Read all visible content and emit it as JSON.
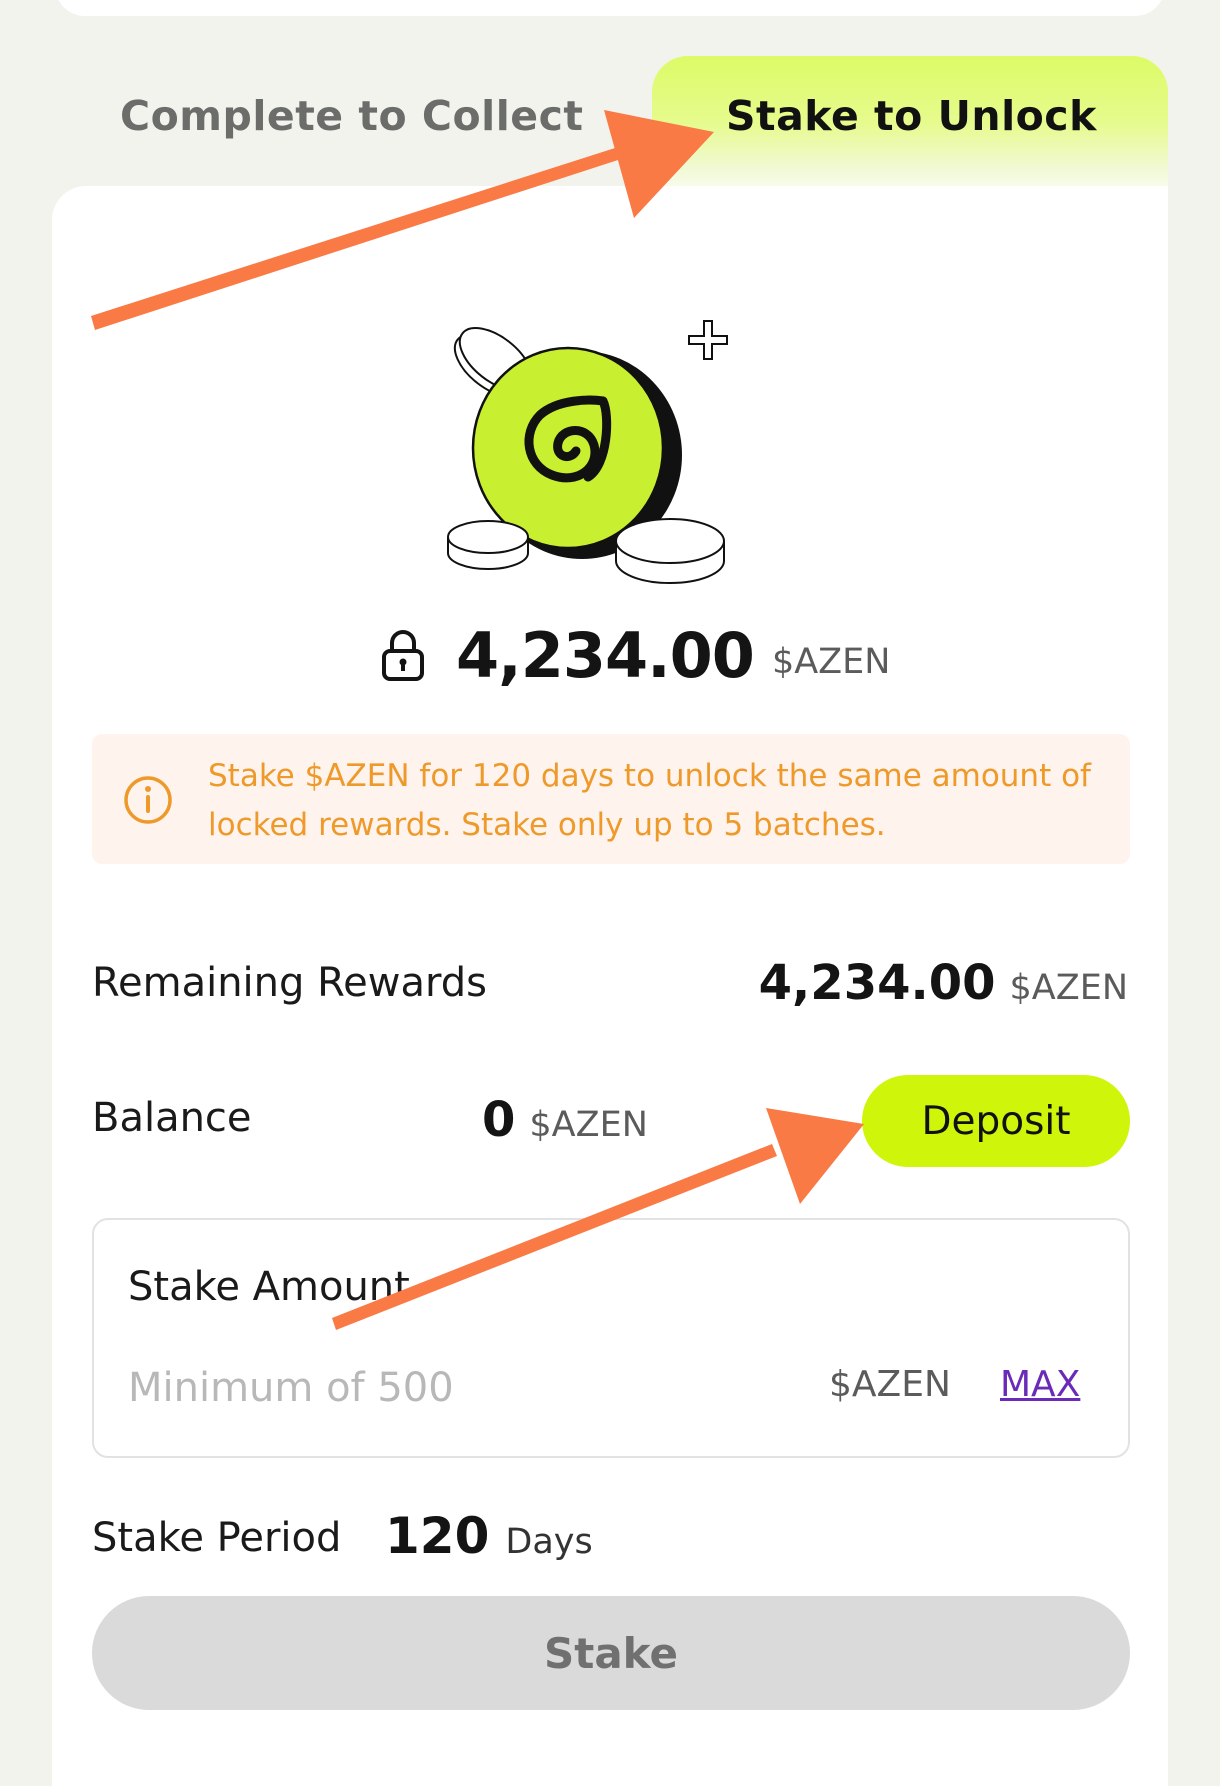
{
  "tabs": {
    "complete_to_collect": "Complete to Collect",
    "stake_to_unlock": "Stake to Unlock",
    "active": "Stake to Unlock"
  },
  "locked": {
    "amount": "4,234.00",
    "unit": "$AZEN"
  },
  "notice": {
    "text": "Stake $AZEN for 120 days to unlock the same amount of locked rewards. Stake only up to 5 batches."
  },
  "remaining_rewards": {
    "label": "Remaining Rewards",
    "amount": "4,234.00",
    "unit": "$AZEN"
  },
  "balance": {
    "label": "Balance",
    "amount": "0",
    "unit": "$AZEN",
    "deposit_label": "Deposit"
  },
  "stake_amount": {
    "label": "Stake Amount",
    "placeholder": "Minimum of 500",
    "value": "",
    "unit": "$AZEN",
    "max_label": "MAX"
  },
  "stake_period": {
    "label": "Stake Period",
    "amount": "120",
    "unit": "Days"
  },
  "stake_button": {
    "label": "Stake",
    "state": "disabled"
  },
  "icons": {
    "coin_illustration": "azen-coin-stack",
    "lock": "lock-icon",
    "info": "info-icon",
    "sparkle": "plus-sparkle-icon"
  },
  "colors": {
    "accent": "#cff50a",
    "annotation_arrow": "#f97a45",
    "notice_bg": "#fff3ee",
    "notice_text": "#ee9a2a",
    "max_link": "#6a2bb8",
    "disabled_button": "#dadada"
  }
}
